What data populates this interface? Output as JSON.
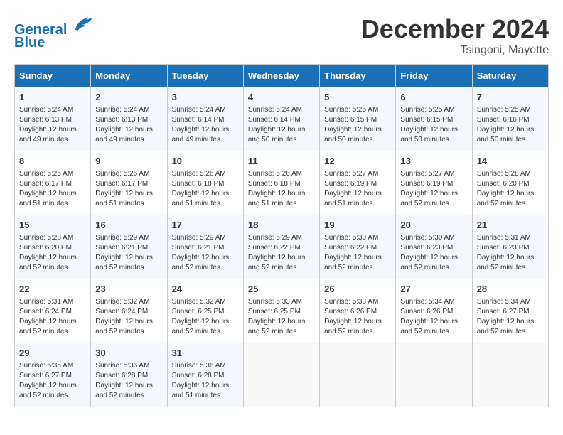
{
  "header": {
    "logo_line1": "General",
    "logo_line2": "Blue",
    "month": "December 2024",
    "location": "Tsingoni, Mayotte"
  },
  "days_of_week": [
    "Sunday",
    "Monday",
    "Tuesday",
    "Wednesday",
    "Thursday",
    "Friday",
    "Saturday"
  ],
  "weeks": [
    [
      {
        "day": "1",
        "info": "Sunrise: 5:24 AM\nSunset: 6:13 PM\nDaylight: 12 hours\nand 49 minutes."
      },
      {
        "day": "2",
        "info": "Sunrise: 5:24 AM\nSunset: 6:13 PM\nDaylight: 12 hours\nand 49 minutes."
      },
      {
        "day": "3",
        "info": "Sunrise: 5:24 AM\nSunset: 6:14 PM\nDaylight: 12 hours\nand 49 minutes."
      },
      {
        "day": "4",
        "info": "Sunrise: 5:24 AM\nSunset: 6:14 PM\nDaylight: 12 hours\nand 50 minutes."
      },
      {
        "day": "5",
        "info": "Sunrise: 5:25 AM\nSunset: 6:15 PM\nDaylight: 12 hours\nand 50 minutes."
      },
      {
        "day": "6",
        "info": "Sunrise: 5:25 AM\nSunset: 6:15 PM\nDaylight: 12 hours\nand 50 minutes."
      },
      {
        "day": "7",
        "info": "Sunrise: 5:25 AM\nSunset: 6:16 PM\nDaylight: 12 hours\nand 50 minutes."
      }
    ],
    [
      {
        "day": "8",
        "info": "Sunrise: 5:25 AM\nSunset: 6:17 PM\nDaylight: 12 hours\nand 51 minutes."
      },
      {
        "day": "9",
        "info": "Sunrise: 5:26 AM\nSunset: 6:17 PM\nDaylight: 12 hours\nand 51 minutes."
      },
      {
        "day": "10",
        "info": "Sunrise: 5:26 AM\nSunset: 6:18 PM\nDaylight: 12 hours\nand 51 minutes."
      },
      {
        "day": "11",
        "info": "Sunrise: 5:26 AM\nSunset: 6:18 PM\nDaylight: 12 hours\nand 51 minutes."
      },
      {
        "day": "12",
        "info": "Sunrise: 5:27 AM\nSunset: 6:19 PM\nDaylight: 12 hours\nand 51 minutes."
      },
      {
        "day": "13",
        "info": "Sunrise: 5:27 AM\nSunset: 6:19 PM\nDaylight: 12 hours\nand 52 minutes."
      },
      {
        "day": "14",
        "info": "Sunrise: 5:28 AM\nSunset: 6:20 PM\nDaylight: 12 hours\nand 52 minutes."
      }
    ],
    [
      {
        "day": "15",
        "info": "Sunrise: 5:28 AM\nSunset: 6:20 PM\nDaylight: 12 hours\nand 52 minutes."
      },
      {
        "day": "16",
        "info": "Sunrise: 5:29 AM\nSunset: 6:21 PM\nDaylight: 12 hours\nand 52 minutes."
      },
      {
        "day": "17",
        "info": "Sunrise: 5:29 AM\nSunset: 6:21 PM\nDaylight: 12 hours\nand 52 minutes."
      },
      {
        "day": "18",
        "info": "Sunrise: 5:29 AM\nSunset: 6:22 PM\nDaylight: 12 hours\nand 52 minutes."
      },
      {
        "day": "19",
        "info": "Sunrise: 5:30 AM\nSunset: 6:22 PM\nDaylight: 12 hours\nand 52 minutes."
      },
      {
        "day": "20",
        "info": "Sunrise: 5:30 AM\nSunset: 6:23 PM\nDaylight: 12 hours\nand 52 minutes."
      },
      {
        "day": "21",
        "info": "Sunrise: 5:31 AM\nSunset: 6:23 PM\nDaylight: 12 hours\nand 52 minutes."
      }
    ],
    [
      {
        "day": "22",
        "info": "Sunrise: 5:31 AM\nSunset: 6:24 PM\nDaylight: 12 hours\nand 52 minutes."
      },
      {
        "day": "23",
        "info": "Sunrise: 5:32 AM\nSunset: 6:24 PM\nDaylight: 12 hours\nand 52 minutes."
      },
      {
        "day": "24",
        "info": "Sunrise: 5:32 AM\nSunset: 6:25 PM\nDaylight: 12 hours\nand 52 minutes."
      },
      {
        "day": "25",
        "info": "Sunrise: 5:33 AM\nSunset: 6:25 PM\nDaylight: 12 hours\nand 52 minutes."
      },
      {
        "day": "26",
        "info": "Sunrise: 5:33 AM\nSunset: 6:26 PM\nDaylight: 12 hours\nand 52 minutes."
      },
      {
        "day": "27",
        "info": "Sunrise: 5:34 AM\nSunset: 6:26 PM\nDaylight: 12 hours\nand 52 minutes."
      },
      {
        "day": "28",
        "info": "Sunrise: 5:34 AM\nSunset: 6:27 PM\nDaylight: 12 hours\nand 52 minutes."
      }
    ],
    [
      {
        "day": "29",
        "info": "Sunrise: 5:35 AM\nSunset: 6:27 PM\nDaylight: 12 hours\nand 52 minutes."
      },
      {
        "day": "30",
        "info": "Sunrise: 5:36 AM\nSunset: 6:28 PM\nDaylight: 12 hours\nand 52 minutes."
      },
      {
        "day": "31",
        "info": "Sunrise: 5:36 AM\nSunset: 6:28 PM\nDaylight: 12 hours\nand 51 minutes."
      },
      {
        "day": "",
        "info": ""
      },
      {
        "day": "",
        "info": ""
      },
      {
        "day": "",
        "info": ""
      },
      {
        "day": "",
        "info": ""
      }
    ]
  ]
}
